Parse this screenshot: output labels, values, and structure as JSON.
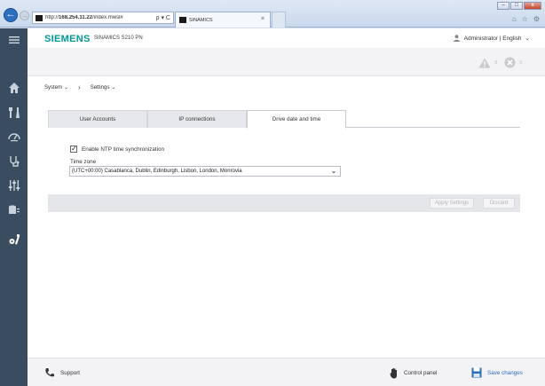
{
  "browser": {
    "url_prefix": "http://",
    "url_host": "168.254.11.22",
    "url_path": "/index.mwsl#",
    "search_glyph": "ρ ▾ C",
    "tab_title": "SINAMICS",
    "window_buttons": [
      "–",
      "□",
      "x"
    ],
    "toolbar_icons": [
      "⌂",
      "☆",
      "⚙"
    ]
  },
  "rail": {
    "items": [
      "menu-icon",
      "home-icon",
      "tools-icon",
      "gauge-icon",
      "stethoscope-icon",
      "sliders-icon",
      "database-icon",
      "settings-wrench-icon"
    ]
  },
  "header": {
    "brand": "SIEMENS",
    "product": "SINAMICS S210 PN",
    "user": "Administrator | English"
  },
  "alerts": {
    "warning_count": "0",
    "error_count": "0"
  },
  "breadcrumb": {
    "system": "System",
    "settings": "Settings"
  },
  "tabs": [
    {
      "label": "User Accounts"
    },
    {
      "label": "IP connections"
    },
    {
      "label": "Drive date and time"
    }
  ],
  "form": {
    "ntp_label": "Enable NTP time synchronization",
    "ntp_checked": true,
    "timezone_label": "Time zone",
    "timezone_value": "(UTC+00:00) Casablanca, Dublin, Edinburgh, Lisbon, London, Monrovia"
  },
  "actions": {
    "apply": "Apply Settings",
    "discard": "Discard"
  },
  "footer": {
    "support": "Support",
    "control_panel": "Control panel",
    "save_changes": "Save changes"
  },
  "colors": {
    "brand": "#009999",
    "rail": "#3a4c60",
    "accent": "#2b6cbd"
  }
}
